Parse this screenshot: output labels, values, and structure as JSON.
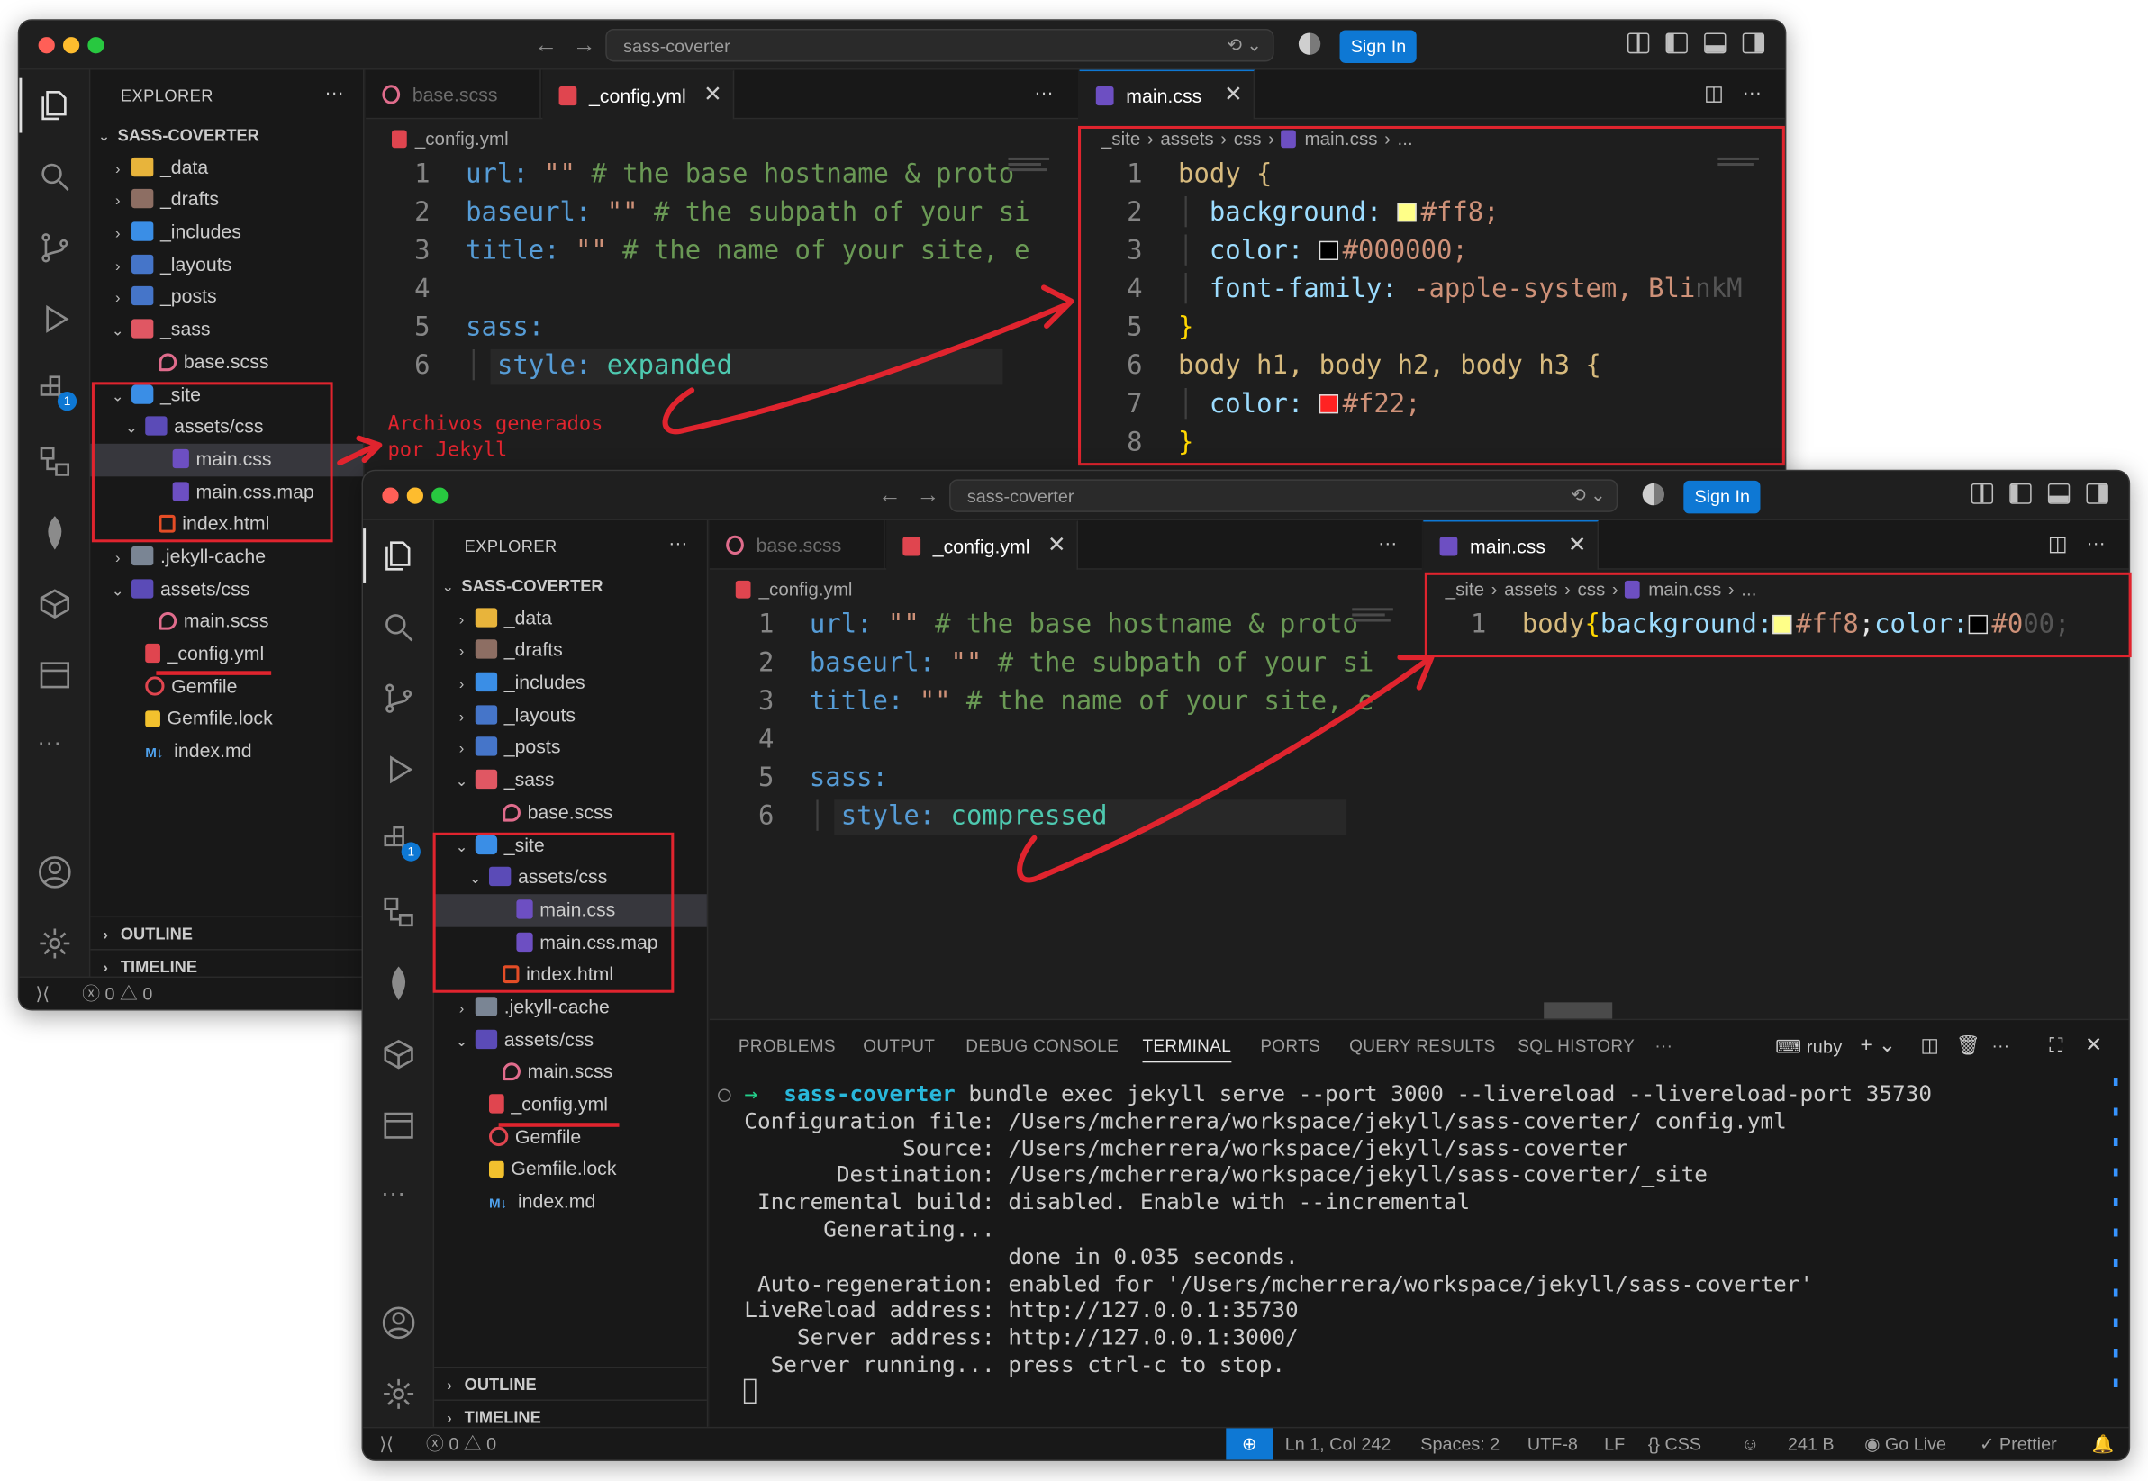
{
  "windows": {
    "back": {
      "command_center": "sass-coverter",
      "sign_in": "Sign In",
      "explorer": {
        "header": "EXPLORER",
        "more": "···",
        "root": "SASS-COVERTER",
        "items": [
          "_data",
          "_drafts",
          "_includes",
          "_layouts",
          "_posts",
          "_sass",
          "base.scss",
          "_site",
          "assets/css",
          "main.css",
          "main.css.map",
          "index.html",
          ".jekyll-cache",
          "assets/css",
          "main.scss",
          "_config.yml",
          "Gemfile",
          "Gemfile.lock",
          "index.md"
        ],
        "outline": "OUTLINE",
        "timeline": "TIMELINE"
      },
      "badge": "1",
      "status": {
        "errors": "0",
        "warnings": "0"
      },
      "left_tabs": [
        "base.scss",
        "_config.yml"
      ],
      "right_tabs": [
        "main.css"
      ],
      "left_breadcrumb": "_config.yml",
      "right_breadcrumb": [
        "_site",
        "assets",
        "css",
        "main.css",
        "..."
      ],
      "config_lines": [
        {
          "n": "1",
          "key": "url:",
          "val": " \"\"",
          "cmt": " # the base hostname & proto"
        },
        {
          "n": "2",
          "key": "baseurl:",
          "val": " \"\"",
          "cmt": " # the subpath of your si"
        },
        {
          "n": "3",
          "key": "title:",
          "val": " \"\"",
          "cmt": " # the name of your site, e"
        },
        {
          "n": "4",
          "key": "",
          "val": "",
          "cmt": ""
        },
        {
          "n": "5",
          "key": "sass:",
          "val": "",
          "cmt": ""
        },
        {
          "n": "6",
          "key": "style:",
          "val": " expanded",
          "cmt": ""
        }
      ],
      "css_lines": [
        {
          "n": "1",
          "text": "body {"
        },
        {
          "n": "2",
          "prop": "background:",
          "swatch": "#ffff88",
          "value": "#ff8;"
        },
        {
          "n": "3",
          "prop": "color:",
          "swatch": "#000000",
          "value": "#000000;"
        },
        {
          "n": "4",
          "prop": "font-family:",
          "value": "-apple-system, Bli",
          "fade": "nkM"
        },
        {
          "n": "5",
          "text": "}"
        },
        {
          "n": "6",
          "text": "body h1, body h2, body h3 {"
        },
        {
          "n": "7",
          "prop": "color:",
          "swatch": "#ff2222",
          "value": "#f22;"
        },
        {
          "n": "8",
          "text": "}"
        }
      ],
      "annotation": "Archivos generados\npor Jekyll"
    },
    "front": {
      "command_center": "sass-coverter",
      "sign_in": "Sign In",
      "explorer": {
        "header": "EXPLORER",
        "more": "···",
        "root": "SASS-COVERTER",
        "items": [
          "_data",
          "_drafts",
          "_includes",
          "_layouts",
          "_posts",
          "_sass",
          "base.scss",
          "_site",
          "assets/css",
          "main.css",
          "main.css.map",
          "index.html",
          ".jekyll-cache",
          "assets/css",
          "main.scss",
          "_config.yml",
          "Gemfile",
          "Gemfile.lock",
          "index.md"
        ],
        "outline": "OUTLINE",
        "timeline": "TIMELINE"
      },
      "badge": "1",
      "left_tabs": [
        "base.scss",
        "_config.yml"
      ],
      "right_tabs": [
        "main.css"
      ],
      "left_breadcrumb": "_config.yml",
      "right_breadcrumb": [
        "_site",
        "assets",
        "css",
        "main.css",
        "..."
      ],
      "config_lines": [
        {
          "n": "1",
          "key": "url:",
          "val": " \"\"",
          "cmt": " # the base hostname & proto"
        },
        {
          "n": "2",
          "key": "baseurl:",
          "val": " \"\"",
          "cmt": " # the subpath of your si"
        },
        {
          "n": "3",
          "key": "title:",
          "val": " \"\"",
          "cmt": " # the name of your site, e"
        },
        {
          "n": "4",
          "key": "",
          "val": "",
          "cmt": ""
        },
        {
          "n": "5",
          "key": "sass:",
          "val": "",
          "cmt": ""
        },
        {
          "n": "6",
          "key": "style:",
          "val": " compressed",
          "cmt": ""
        }
      ],
      "css_min": {
        "n": "1",
        "sel": "body",
        "brace": "{",
        "prop1": "background:",
        "sw1": "#ffff88",
        "v1": "#ff8",
        "semi": ";",
        "prop2": "color:",
        "sw2": "#000000",
        "v2": "#0",
        "fade": "00;"
      },
      "panel_tabs": [
        "PROBLEMS",
        "OUTPUT",
        "DEBUG CONSOLE",
        "TERMINAL",
        "PORTS",
        "QUERY RESULTS",
        "SQL HISTORY",
        "···"
      ],
      "terminal_profile": "ruby",
      "terminal": {
        "prompt_dir": "sass-coverter",
        "command": " bundle exec jekyll serve --port 3000 --livereload --livereload-port 35730",
        "lines": [
          "Configuration file: /Users/mcherrera/workspace/jekyll/sass-coverter/_config.yml",
          "            Source: /Users/mcherrera/workspace/jekyll/sass-coverter",
          "       Destination: /Users/mcherrera/workspace/jekyll/sass-coverter/_site",
          " Incremental build: disabled. Enable with --incremental",
          "      Generating...",
          "                    done in 0.035 seconds.",
          " Auto-regeneration: enabled for '/Users/mcherrera/workspace/jekyll/sass-coverter'",
          "LiveReload address: http://127.0.0.1:35730",
          "    Server address: http://127.0.0.1:3000/",
          "  Server running... press ctrl-c to stop."
        ]
      },
      "status": {
        "errors": "0",
        "warnings": "0",
        "position": "Ln 1, Col 242",
        "spaces": "Spaces: 2",
        "encoding": "UTF-8",
        "eol": "LF",
        "language": "CSS",
        "size": "241 B",
        "golive": "Go Live",
        "prettier": "Prettier"
      }
    }
  },
  "colors": {
    "accent": "#0e78d4",
    "annotation": "#e0242e"
  }
}
